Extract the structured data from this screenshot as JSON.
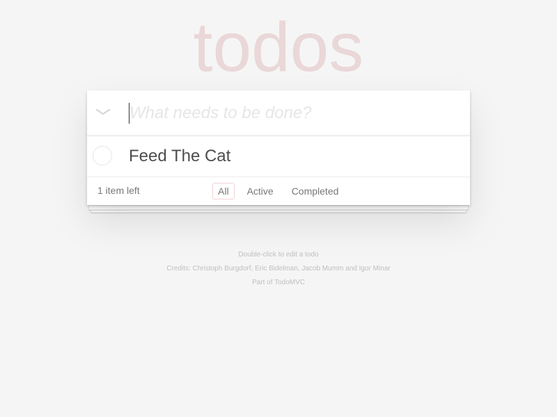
{
  "app": {
    "title": "todos"
  },
  "header": {
    "placeholder": "What needs to be done?",
    "toggle_all_icon": "chevron-down-icon"
  },
  "todos": [
    {
      "label": "Feed The Cat",
      "completed": false
    }
  ],
  "footer": {
    "count_text": "1 item left",
    "filters": [
      "All",
      "Active",
      "Completed"
    ],
    "selected_filter": "All"
  },
  "info": {
    "edit_hint": "Double-click to edit a todo",
    "credits": "Credits: Christoph Burgdorf, Eric Bidelman, Jacob Mumm and Igor Minar",
    "part_of": "Part of TodoMVC"
  },
  "colors": {
    "background": "#f5f5f5",
    "title": "#ead7d7",
    "selected_filter_border": "#af2f2f"
  }
}
